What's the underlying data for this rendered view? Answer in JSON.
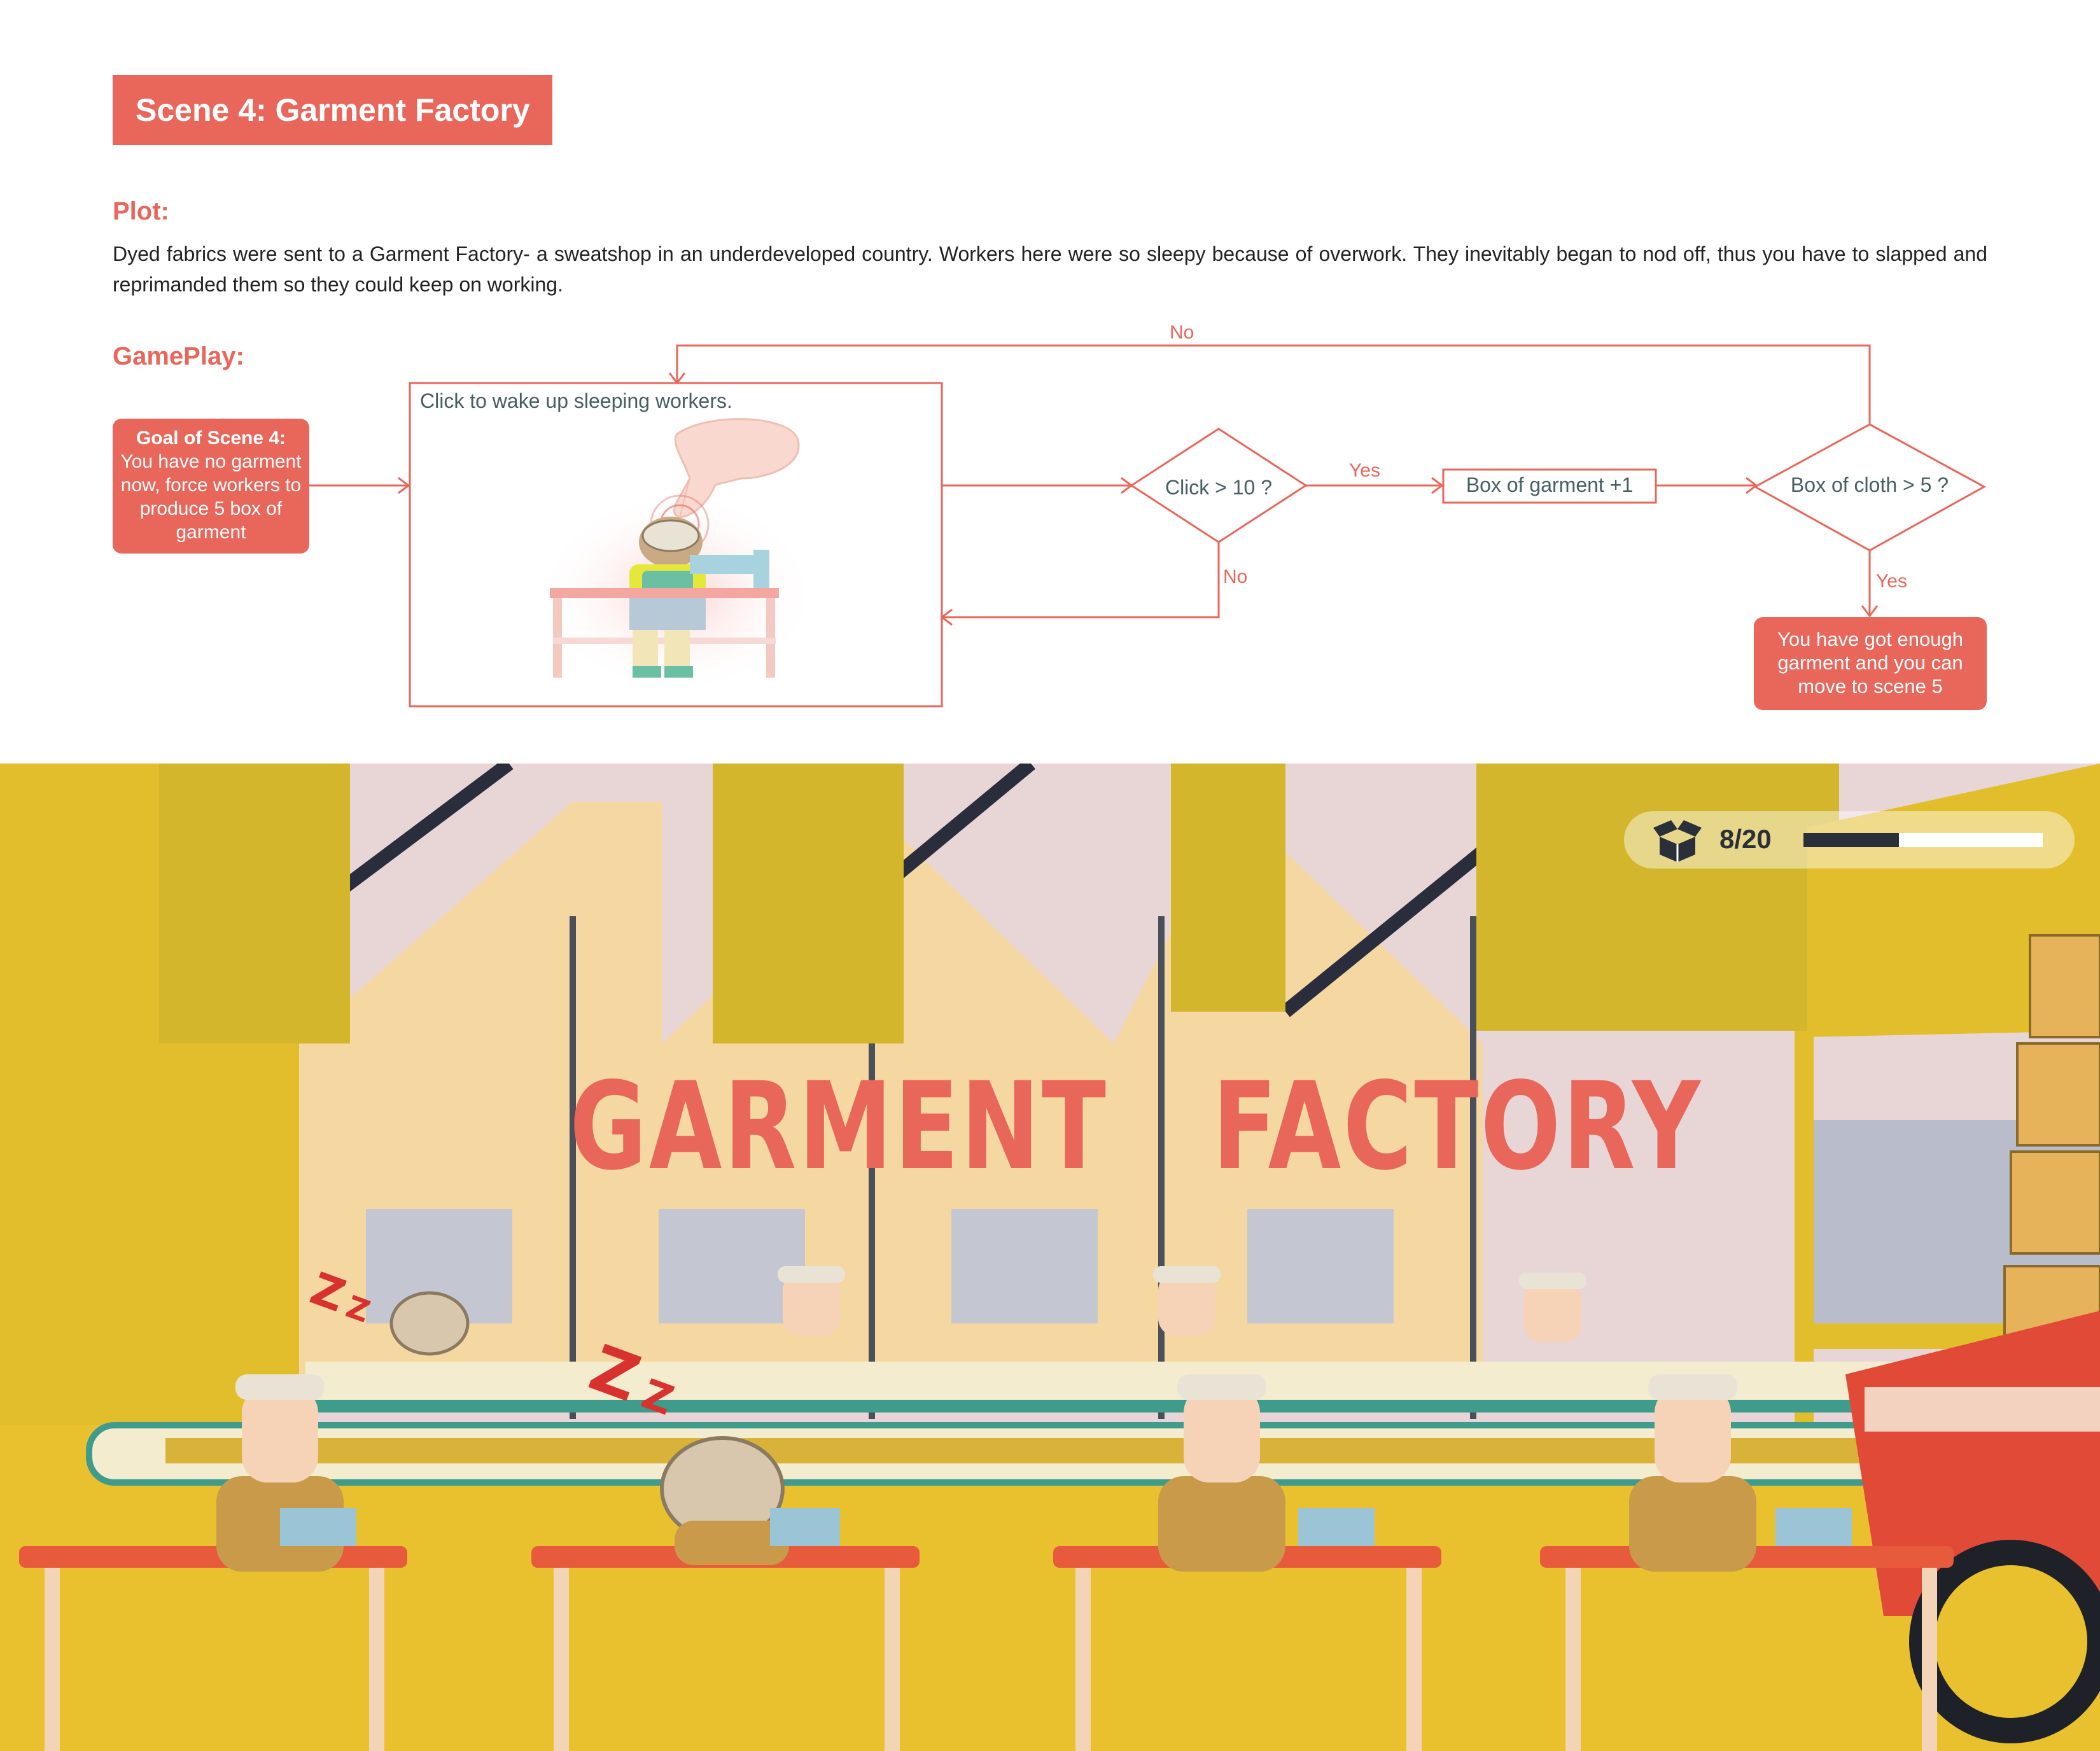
{
  "title": "Scene 4: Garment Factory",
  "plot": {
    "label": "Plot:",
    "text": "Dyed fabrics were sent to a Garment Factory- a sweatshop in an underdeveloped country. Workers here were so sleepy because of overwork. They inevitably began to nod off, thus you have to slapped and reprimanded them so they could keep on working."
  },
  "gameplay": {
    "label": "GamePlay:",
    "goal_title": "Goal of  Scene 4:",
    "goal_text": "You have no garment now, force workers to produce 5 box of garment",
    "instruction": "Click to wake up sleeping workers.",
    "decision_click": "Click > 10 ?",
    "box_garment": "Box of garment +1",
    "decision_cloth": "Box of cloth > 5 ?",
    "end_text": "You have got enough garment and you can move to scene 5",
    "yes_label": "Yes",
    "no_label": "No"
  },
  "scene": {
    "sign": "GARMENT   FACTORY",
    "sleep_mark": "Z",
    "hud": {
      "icon": "open-box-icon",
      "count": "8/20",
      "progress": 0.4
    }
  },
  "colors": {
    "accent": "#e9665b",
    "node_text": "#455e63",
    "wall": "#f5d7a1",
    "yellow": "#e3be2c"
  }
}
